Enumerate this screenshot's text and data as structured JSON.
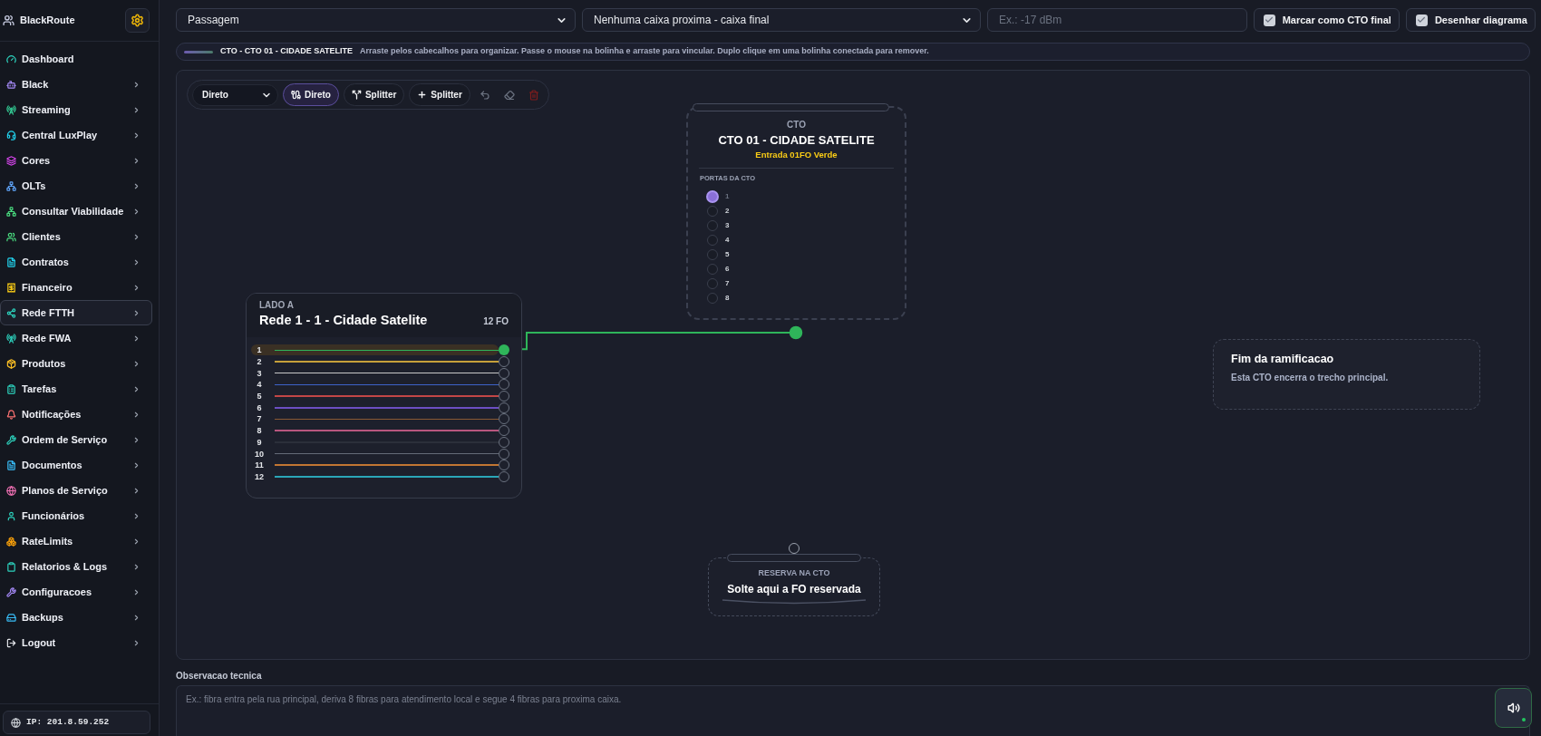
{
  "sidebar": {
    "brand": "BlackRoute",
    "items": [
      {
        "label": "Dashboard",
        "expandable": false,
        "selected": false
      },
      {
        "label": "Black",
        "expandable": true,
        "selected": false
      },
      {
        "label": "Streaming",
        "expandable": true,
        "selected": false
      },
      {
        "label": "Central LuxPlay",
        "expandable": true,
        "selected": false
      },
      {
        "label": "Cores",
        "expandable": true,
        "selected": false
      },
      {
        "label": "OLTs",
        "expandable": true,
        "selected": false
      },
      {
        "label": "Consultar Viabilidade",
        "expandable": true,
        "selected": false
      },
      {
        "label": "Clientes",
        "expandable": true,
        "selected": false
      },
      {
        "label": "Contratos",
        "expandable": true,
        "selected": false
      },
      {
        "label": "Financeiro",
        "expandable": true,
        "selected": false
      },
      {
        "label": "Rede FTTH",
        "expandable": true,
        "selected": true
      },
      {
        "label": "Rede FWA",
        "expandable": true,
        "selected": false
      },
      {
        "label": "Produtos",
        "expandable": true,
        "selected": false
      },
      {
        "label": "Tarefas",
        "expandable": true,
        "selected": false
      },
      {
        "label": "Notificações",
        "expandable": true,
        "selected": false
      },
      {
        "label": "Ordem de Serviço",
        "expandable": true,
        "selected": false
      },
      {
        "label": "Documentos",
        "expandable": true,
        "selected": false
      },
      {
        "label": "Planos de Serviço",
        "expandable": true,
        "selected": false
      },
      {
        "label": "Funcionários",
        "expandable": true,
        "selected": false
      },
      {
        "label": "RateLimits",
        "expandable": true,
        "selected": false
      },
      {
        "label": "Relatorios & Logs",
        "expandable": true,
        "selected": false
      },
      {
        "label": "Configuracoes",
        "expandable": true,
        "selected": false
      },
      {
        "label": "Backups",
        "expandable": true,
        "selected": false
      },
      {
        "label": "Logout",
        "expandable": true,
        "selected": false
      }
    ],
    "ip": "IP: 201.8.59.252"
  },
  "form": {
    "connection_type": {
      "value": "Passagem"
    },
    "next_box": {
      "value": "Nenhuma caixa proxima - caixa final"
    },
    "loss": {
      "placeholder": "Ex.: -17 dBm"
    },
    "checkboxes": [
      {
        "label": "Marcar como CTO final",
        "checked": true
      },
      {
        "label": "Desenhar diagrama",
        "checked": true
      }
    ]
  },
  "hint_bar": {
    "title": "CTO - CTO 01 - CIDADE SATELITE",
    "text": "Arraste pelos cabecalhos para organizar. Passe o mouse na bolinha e arraste para vincular. Duplo clique em uma bolinha conectada para remover."
  },
  "canvas": {
    "toolbar": {
      "mode_select": "Direto",
      "tools": [
        {
          "label": "Direto",
          "kind": "direct",
          "selected": true
        },
        {
          "label": "Splitter",
          "kind": "split",
          "selected": false
        },
        {
          "label": "Splitter",
          "kind": "add",
          "selected": false
        }
      ],
      "actions": [
        {
          "kind": "undo"
        },
        {
          "kind": "erase"
        },
        {
          "kind": "delete"
        }
      ]
    },
    "cto": {
      "label": "CTO",
      "title": "CTO 01 - CIDADE SATELITE",
      "input": "Entrada 01FO Verde",
      "ports_label": "PORTAS DA CTO",
      "ports": [
        {
          "number": "1",
          "connected": true
        },
        {
          "number": "2",
          "connected": false
        },
        {
          "number": "3",
          "connected": false
        },
        {
          "number": "4",
          "connected": false
        },
        {
          "number": "5",
          "connected": false
        },
        {
          "number": "6",
          "connected": false
        },
        {
          "number": "7",
          "connected": false
        },
        {
          "number": "8",
          "connected": false
        }
      ]
    },
    "cable": {
      "side": "LADO A",
      "title": "Rede 1 - 1 - Cidade Satelite",
      "count": "12 FO",
      "fibers": [
        {
          "number": "1",
          "color": "#2fb55a",
          "connected": true
        },
        {
          "number": "2",
          "color": "#c6a03a",
          "connected": false
        },
        {
          "number": "3",
          "color": "#c8c8c8",
          "connected": false
        },
        {
          "number": "4",
          "color": "#3d63c9",
          "connected": false
        },
        {
          "number": "5",
          "color": "#c24646",
          "connected": false
        },
        {
          "number": "6",
          "color": "#6c4ec2",
          "connected": false
        },
        {
          "number": "7",
          "color": "#8a5a34",
          "connected": false
        },
        {
          "number": "8",
          "color": "#b8567e",
          "connected": false
        },
        {
          "number": "9",
          "color": "#2b2f3a",
          "connected": false
        },
        {
          "number": "10",
          "color": "#646b78",
          "connected": false
        },
        {
          "number": "11",
          "color": "#c27632",
          "connected": false
        },
        {
          "number": "12",
          "color": "#2aa6b8",
          "connected": false
        }
      ]
    },
    "end_note": {
      "title": "Fim da ramificacao",
      "text": "Esta CTO encerra o trecho principal."
    },
    "reserve": {
      "label": "RESERVA NA CTO",
      "text": "Solte aqui a FO reservada"
    }
  },
  "notes": {
    "label": "Observacao tecnica",
    "placeholder": "Ex.: fibra entra pela rua principal, deriva 8 fibras para atendimento local e segue 4 fibras para proxima caixa."
  }
}
